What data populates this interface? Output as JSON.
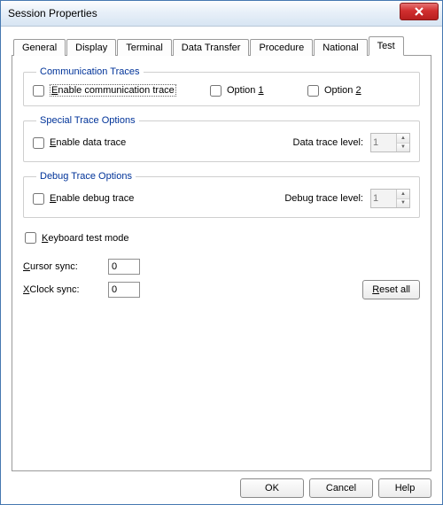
{
  "window": {
    "title": "Session Properties"
  },
  "tabs": [
    {
      "label": "General"
    },
    {
      "label": "Display"
    },
    {
      "label": "Terminal"
    },
    {
      "label": "Data Transfer"
    },
    {
      "label": "Procedure"
    },
    {
      "label": "National"
    },
    {
      "label": "Test"
    }
  ],
  "groups": {
    "comm": {
      "legend": "Communication Traces",
      "enable_pre": "E",
      "enable_post": "nable communication trace",
      "opt1_pre": "Option ",
      "opt1_post": "1",
      "opt2_pre": "Option ",
      "opt2_post": "2"
    },
    "special": {
      "legend": "Special Trace Options",
      "dt_pre": "E",
      "dt_post": "nable data trace",
      "level_label": "Data trace level:",
      "level_value": "1"
    },
    "debug": {
      "legend": "Debug Trace Options",
      "dbg_pre": "E",
      "dbg_post": "nable debug trace",
      "level_label": "Debug trace level:",
      "level_value": "1"
    }
  },
  "kbtest_pre": "K",
  "kbtest_post": "eyboard test mode",
  "cursor_pre": "C",
  "cursor_post": "ursor sync:",
  "cursor_value": "0",
  "xclock_pre": "X",
  "xclock_post": "Clock sync:",
  "xclock_value": "0",
  "buttons": {
    "reset_pre": "R",
    "reset_post": "eset all",
    "ok": "OK",
    "cancel": "Cancel",
    "help": "Help"
  }
}
